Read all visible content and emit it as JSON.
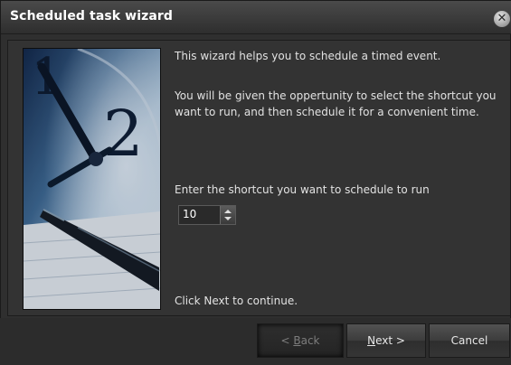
{
  "window": {
    "title": "Scheduled task wizard"
  },
  "body": {
    "intro": "This wizard helps you to schedule a timed event.",
    "description_line1": "You will be given the oppertunity to select the shortcut you",
    "description_line2": "want to run, and then schedule it for a convenient time.",
    "shortcut_prompt": "Enter the shortcut you want to schedule to run",
    "shortcut_value": "10",
    "continue_hint": "Click Next to continue."
  },
  "buttons": {
    "back_prefix": "< ",
    "back_access": "B",
    "back_rest": "ack",
    "next_access": "N",
    "next_rest": "ext >",
    "cancel": "Cancel"
  },
  "icons": {
    "close": "close-icon",
    "spin_up": "arrow-up-icon",
    "spin_down": "arrow-down-icon"
  },
  "colors": {
    "background": "#2f2f2f",
    "text": "#e2e2e2",
    "title": "#ffffff"
  }
}
